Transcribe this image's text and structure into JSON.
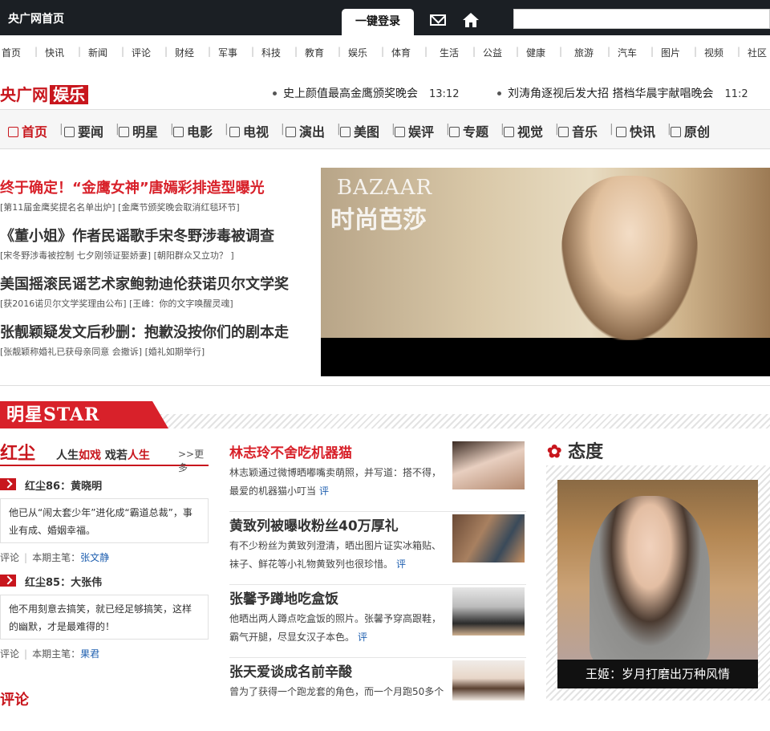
{
  "topbar": {
    "site_home": "央广网首页",
    "login_tab": "一键登录",
    "icons": [
      "mail-icon",
      "home-icon"
    ]
  },
  "nav": {
    "items": [
      "首页",
      "快讯",
      "新闻",
      "评论",
      "财经",
      "军事",
      "科技",
      "教育",
      "娱乐",
      "体育",
      "生活",
      "公益",
      "健康",
      "旅游",
      "汽车",
      "图片",
      "视频",
      "社区"
    ]
  },
  "logo": {
    "part1": "央广网",
    "part2": "娱乐"
  },
  "ticker": [
    {
      "text": "史上颜值最高金鹰颁奖晚会",
      "time": "13:12"
    },
    {
      "text": "刘涛角逐视后发大招 搭档华晨宇献唱晚会",
      "time": "11:2"
    }
  ],
  "channels": [
    "首页",
    "要闻",
    "明星",
    "电影",
    "电视",
    "演出",
    "美图",
    "娱评",
    "专题",
    "视觉",
    "音乐",
    "快讯",
    "原创"
  ],
  "headlines": [
    {
      "title": "终于确定！“金鹰女神”唐嫣彩排造型曝光",
      "sub": "[第11届金鹰奖提名名单出炉] [金鹰节颁奖晚会取消红毯环节]"
    },
    {
      "title": "《董小姐》作者民谣歌手宋冬野涉毒被调查",
      "sub": "[宋冬野涉毒被控制 七夕刚领证娶娇妻] [朝阳群众又立功？ ]"
    },
    {
      "title": "美国摇滚民谣艺术家鲍勃迪伦获诺贝尔文学奖",
      "sub": "[获2016诺贝尔文学奖理由公布] [王峰：你的文字唤醒灵魂]"
    },
    {
      "title": "张靓颖疑发文后秒删：抱歉没按你们的剧本走",
      "sub": "[张靓颖称婚礼已获母亲同意 会撤诉] [婚礼如期举行]"
    }
  ],
  "hero": {
    "brand": "BAZAAR",
    "brand_cn": "时尚芭莎"
  },
  "star_section": {
    "title": "明星STAR"
  },
  "hongchen": {
    "title": "红尘",
    "slogan_a": "人生",
    "slogan_b": "如戏",
    "slogan_c": "戏若",
    "slogan_d": "人生",
    "more": ">>更多",
    "items": [
      {
        "name": "红尘86：黄晓明",
        "text": "他已从“闹太套少年”进化成“霸道总裁”，事业有成、婚姻幸福。",
        "comment": "评论",
        "editor_label": "本期主笔：",
        "editor": "张文静"
      },
      {
        "name": "红尘85：大张伟",
        "text": "他不用刻意去搞笑，就已经足够搞笑，这样的幽默，才是最难得的！",
        "comment": "评论",
        "editor_label": "本期主笔：",
        "editor": "果君"
      }
    ],
    "next_section": "评论"
  },
  "news": [
    {
      "title": "林志玲不舍吃机器猫",
      "desc": "林志颖通过微博晒嘟嘴卖萌照，并写道：搭不得，最爱的机器猫小叮当",
      "comment": "评"
    },
    {
      "title": "黄致列被曝收粉丝40万厚礼",
      "desc": "有不少粉丝为黄致列澄清，晒出图片证实冰箱贴、袜子、鲜花等小礼物黄致列也很珍惜。",
      "comment": "评"
    },
    {
      "title": "张馨予蹲地吃盒饭",
      "desc": "他晒出两人蹲点吃盒饭的照片。张馨予穿高跟鞋，霸气开腿，尽显女汉子本色。",
      "comment": "评"
    },
    {
      "title": "张天爱谈成名前辛酸",
      "desc": "曾为了获得一个跑龙套的角色，而一个月跑50多个",
      "comment": ""
    }
  ],
  "taidu": {
    "title": "态度",
    "caption": "王姬：岁月打磨出万种风情"
  }
}
